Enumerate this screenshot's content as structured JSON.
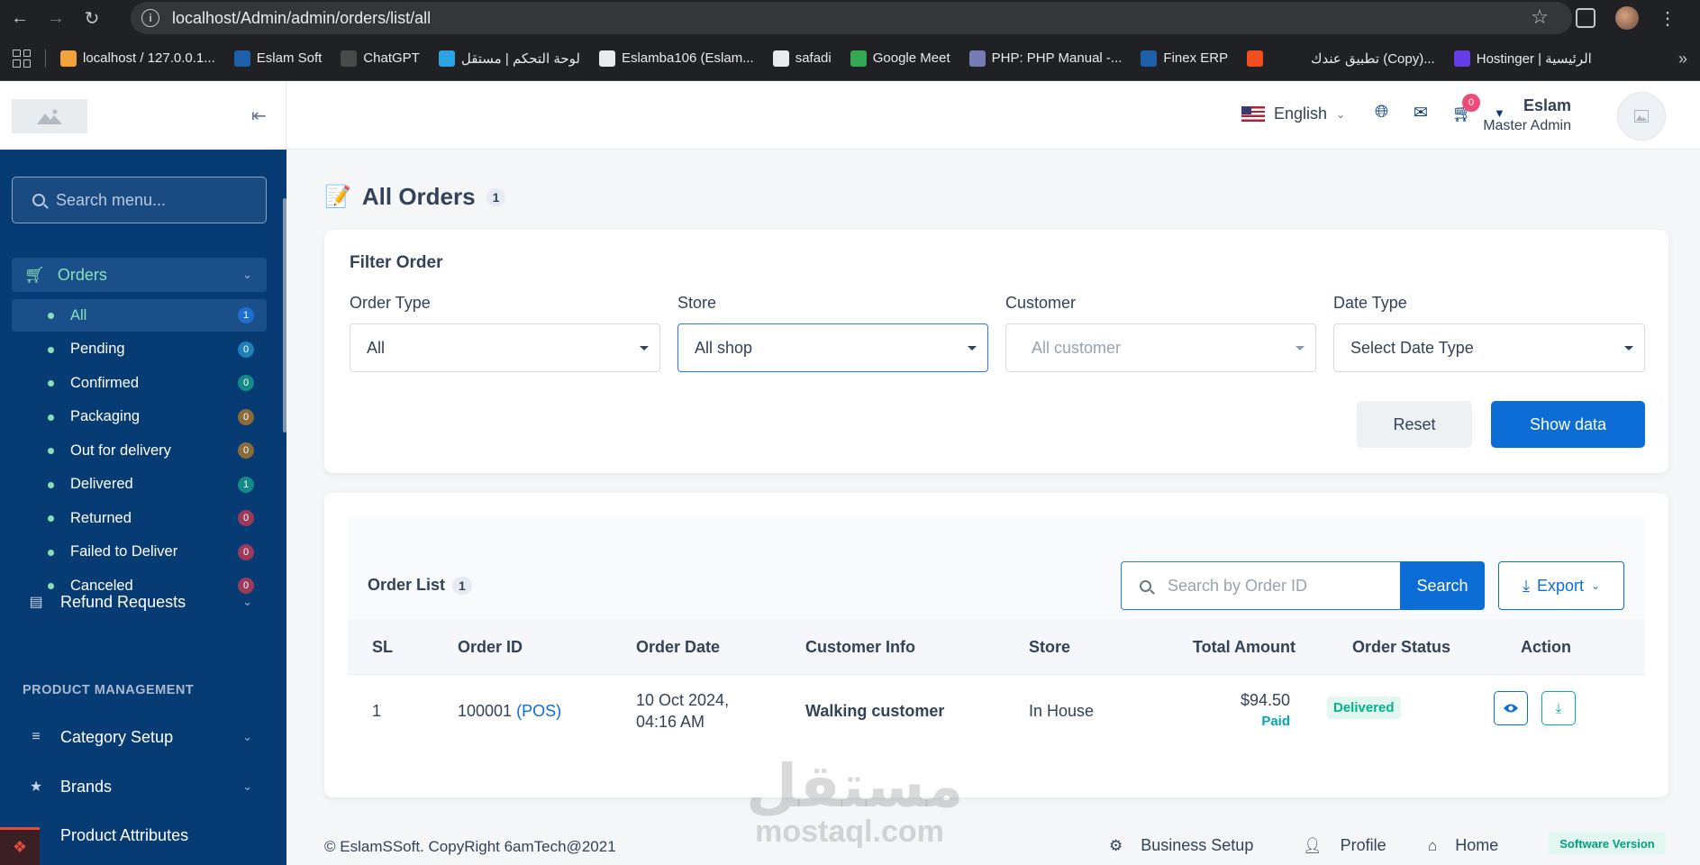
{
  "browser": {
    "url": "localhost/Admin/admin/orders/list/all",
    "bookmarks": [
      {
        "label": "localhost / 127.0.0.1...",
        "color": "#f2a23a"
      },
      {
        "label": "Eslam Soft",
        "color": "#1d5fa8"
      },
      {
        "label": "ChatGPT",
        "color": "#4a4a4a"
      },
      {
        "label": "لوحة التحكم | مستقل",
        "color": "#2aa4e2"
      },
      {
        "label": "Eslamba106 (Eslam...",
        "color": "#e8eaed"
      },
      {
        "label": "safadi",
        "color": "#e8eaed"
      },
      {
        "label": "Google Meet",
        "color": "#34a853"
      },
      {
        "label": "PHP: PHP Manual -...",
        "color": "#777bb3"
      },
      {
        "label": "Finex ERP",
        "color": "#1d5fa8"
      },
      {
        "label": "",
        "color": "#f24e1e"
      },
      {
        "label": "تطبيق عندك (Copy)...",
        "color": "#202124"
      },
      {
        "label": "Hostinger | الرئيسية",
        "color": "#673de6"
      }
    ]
  },
  "sidebar": {
    "search_placeholder": "Search menu...",
    "orders_label": "Orders",
    "sub_items": [
      {
        "label": "All",
        "count": "1",
        "active": true,
        "badge_bg": "#1f6fd0",
        "badge_fg": "#ffffff"
      },
      {
        "label": "Pending",
        "count": "0",
        "badge_bg": "#1f7fb8",
        "badge_fg": "#ffffff"
      },
      {
        "label": "Confirmed",
        "count": "0",
        "badge_bg": "#138a86",
        "badge_fg": "#ffffff"
      },
      {
        "label": "Packaging",
        "count": "0",
        "badge_bg": "#8a6a3a",
        "badge_fg": "#ffffff"
      },
      {
        "label": "Out for delivery",
        "count": "0",
        "badge_bg": "#8a6a3a",
        "badge_fg": "#ffffff"
      },
      {
        "label": "Delivered",
        "count": "1",
        "badge_bg": "#138a86",
        "badge_fg": "#ffffff"
      },
      {
        "label": "Returned",
        "count": "0",
        "badge_bg": "#9b3a5a",
        "badge_fg": "#ffffff"
      },
      {
        "label": "Failed to Deliver",
        "count": "0",
        "badge_bg": "#9b3a5a",
        "badge_fg": "#ffffff"
      },
      {
        "label": "Canceled",
        "count": "0",
        "badge_bg": "#9b3a5a",
        "badge_fg": "#ffffff"
      }
    ],
    "refund_label": "Refund Requests",
    "section_product": "PRODUCT MANAGEMENT",
    "category_label": "Category Setup",
    "brands_label": "Brands",
    "attributes_label": "Product Attributes"
  },
  "header": {
    "language": "English",
    "cart_count": "0",
    "user_name": "Eslam",
    "user_role": "Master Admin"
  },
  "page": {
    "title": "All Orders",
    "count": "1"
  },
  "filter": {
    "title": "Filter Order",
    "order_type_label": "Order Type",
    "order_type_value": "All",
    "store_label": "Store",
    "store_value": "All shop",
    "customer_label": "Customer",
    "customer_placeholder": "All customer",
    "date_type_label": "Date Type",
    "date_type_value": "Select Date Type",
    "reset_label": "Reset",
    "show_label": "Show data"
  },
  "order_list": {
    "title": "Order List",
    "count": "1",
    "search_placeholder": "Search by Order ID",
    "search_button": "Search",
    "export_button": "Export",
    "columns": [
      "SL",
      "Order ID",
      "Order Date",
      "Customer Info",
      "Store",
      "Total Amount",
      "Order Status",
      "Action"
    ],
    "rows": [
      {
        "sl": "1",
        "order_id": "100001",
        "order_tag": "(POS)",
        "date_line1": "10 Oct 2024,",
        "date_line2": "04:16 AM",
        "customer": "Walking customer",
        "store": "In House",
        "amount": "$94.50",
        "payment": "Paid",
        "status": "Delivered"
      }
    ]
  },
  "footer": {
    "copyright": "© EslamSSoft. CopyRight 6amTech@2021",
    "business_setup": "Business Setup",
    "profile": "Profile",
    "home": "Home",
    "version": "Software Version"
  },
  "watermark": {
    "arabic": "مستقل",
    "latin": "mostaql.com"
  }
}
